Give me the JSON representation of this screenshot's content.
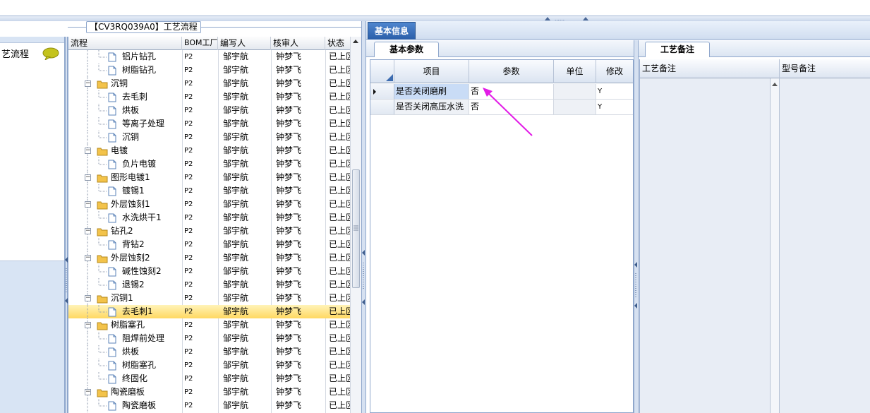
{
  "header": {
    "grip": "‥‥‥"
  },
  "left_panel": {
    "title": "艺流程",
    "icon": "chat-bubble-icon"
  },
  "tree_frame": {
    "title": "【CV3RQ039A0】工艺流程"
  },
  "tree_grid": {
    "columns": [
      "流程",
      "BOM工厂",
      "编写人",
      "核审人",
      "状态"
    ],
    "rows": [
      {
        "level": 2,
        "type": "file",
        "name": "铝片钻孔",
        "bom": "P2",
        "writer": "邹宇航",
        "checker": "钟梦飞",
        "status": "已上区"
      },
      {
        "level": 2,
        "type": "file",
        "name": "树脂钻孔",
        "bom": "P2",
        "writer": "邹宇航",
        "checker": "钟梦飞",
        "status": "已上区"
      },
      {
        "level": 1,
        "type": "folder",
        "name": "沉铜",
        "bom": "P2",
        "writer": "邹宇航",
        "checker": "钟梦飞",
        "status": "已上区"
      },
      {
        "level": 2,
        "type": "file",
        "name": "去毛刺",
        "bom": "P2",
        "writer": "邹宇航",
        "checker": "钟梦飞",
        "status": "已上区"
      },
      {
        "level": 2,
        "type": "file",
        "name": "烘板",
        "bom": "P2",
        "writer": "邹宇航",
        "checker": "钟梦飞",
        "status": "已上区"
      },
      {
        "level": 2,
        "type": "file",
        "name": "等离子处理",
        "bom": "P2",
        "writer": "邹宇航",
        "checker": "钟梦飞",
        "status": "已上区"
      },
      {
        "level": 2,
        "type": "file",
        "name": "沉铜",
        "bom": "P2",
        "writer": "邹宇航",
        "checker": "钟梦飞",
        "status": "已上区"
      },
      {
        "level": 1,
        "type": "folder",
        "name": "电镀",
        "bom": "P2",
        "writer": "邹宇航",
        "checker": "钟梦飞",
        "status": "已上区"
      },
      {
        "level": 2,
        "type": "file",
        "name": "负片电镀",
        "bom": "P2",
        "writer": "邹宇航",
        "checker": "钟梦飞",
        "status": "已上区"
      },
      {
        "level": 1,
        "type": "folder",
        "name": "图形电镀1",
        "bom": "P2",
        "writer": "邹宇航",
        "checker": "钟梦飞",
        "status": "已上区"
      },
      {
        "level": 2,
        "type": "file",
        "name": "镀锡1",
        "bom": "P2",
        "writer": "邹宇航",
        "checker": "钟梦飞",
        "status": "已上区"
      },
      {
        "level": 1,
        "type": "folder",
        "name": "外层蚀刻1",
        "bom": "P2",
        "writer": "邹宇航",
        "checker": "钟梦飞",
        "status": "已上区"
      },
      {
        "level": 2,
        "type": "file",
        "name": "水洗烘干1",
        "bom": "P2",
        "writer": "邹宇航",
        "checker": "钟梦飞",
        "status": "已上区"
      },
      {
        "level": 1,
        "type": "folder",
        "name": "钻孔2",
        "bom": "P2",
        "writer": "邹宇航",
        "checker": "钟梦飞",
        "status": "已上区"
      },
      {
        "level": 2,
        "type": "file",
        "name": "背钻2",
        "bom": "P2",
        "writer": "邹宇航",
        "checker": "钟梦飞",
        "status": "已上区"
      },
      {
        "level": 1,
        "type": "folder",
        "name": "外层蚀刻2",
        "bom": "P2",
        "writer": "邹宇航",
        "checker": "钟梦飞",
        "status": "已上区"
      },
      {
        "level": 2,
        "type": "file",
        "name": "碱性蚀刻2",
        "bom": "P2",
        "writer": "邹宇航",
        "checker": "钟梦飞",
        "status": "已上区"
      },
      {
        "level": 2,
        "type": "file",
        "name": "退锡2",
        "bom": "P2",
        "writer": "邹宇航",
        "checker": "钟梦飞",
        "status": "已上区"
      },
      {
        "level": 1,
        "type": "folder",
        "name": "沉铜1",
        "bom": "P2",
        "writer": "邹宇航",
        "checker": "钟梦飞",
        "status": "已上区"
      },
      {
        "level": 2,
        "type": "file",
        "name": "去毛刺1",
        "bom": "P2",
        "writer": "邹宇航",
        "checker": "钟梦飞",
        "status": "已上区",
        "selected": true
      },
      {
        "level": 1,
        "type": "folder",
        "name": "树脂塞孔",
        "bom": "P2",
        "writer": "邹宇航",
        "checker": "钟梦飞",
        "status": "已上区"
      },
      {
        "level": 2,
        "type": "file",
        "name": "阻焊前处理",
        "bom": "P2",
        "writer": "邹宇航",
        "checker": "钟梦飞",
        "status": "已上区"
      },
      {
        "level": 2,
        "type": "file",
        "name": "烘板",
        "bom": "P2",
        "writer": "邹宇航",
        "checker": "钟梦飞",
        "status": "已上区"
      },
      {
        "level": 2,
        "type": "file",
        "name": "树脂塞孔",
        "bom": "P2",
        "writer": "邹宇航",
        "checker": "钟梦飞",
        "status": "已上区"
      },
      {
        "level": 2,
        "type": "file",
        "name": "终固化",
        "bom": "P2",
        "writer": "邹宇航",
        "checker": "钟梦飞",
        "status": "已上区"
      },
      {
        "level": 1,
        "type": "folder",
        "name": "陶瓷磨板",
        "bom": "P2",
        "writer": "邹宇航",
        "checker": "钟梦飞",
        "status": "已上区"
      },
      {
        "level": 2,
        "type": "file",
        "name": "陶瓷磨板",
        "bom": "P2",
        "writer": "邹宇航",
        "checker": "钟梦飞",
        "status": "已上区"
      }
    ]
  },
  "info_tabs": {
    "active": "基本信息"
  },
  "basic_params": {
    "tab_label": "基本参数",
    "columns": [
      "项目",
      "参数",
      "单位",
      "修改"
    ],
    "rows": [
      {
        "item": "是否关闭磨刷",
        "param": "否",
        "unit": "",
        "modify": "Y",
        "current": true
      },
      {
        "item": "是否关闭高压水洗",
        "param": "否",
        "unit": "",
        "modify": "Y",
        "current": false
      }
    ]
  },
  "process_notes": {
    "tab_label": "工艺备注",
    "columns": [
      "工艺备注",
      "型号备注"
    ]
  },
  "colors": {
    "accent": "#2a5ea9",
    "selection": "#ffd862",
    "annotation_arrow": "#e21ce6",
    "folder": "#f3c34a"
  }
}
